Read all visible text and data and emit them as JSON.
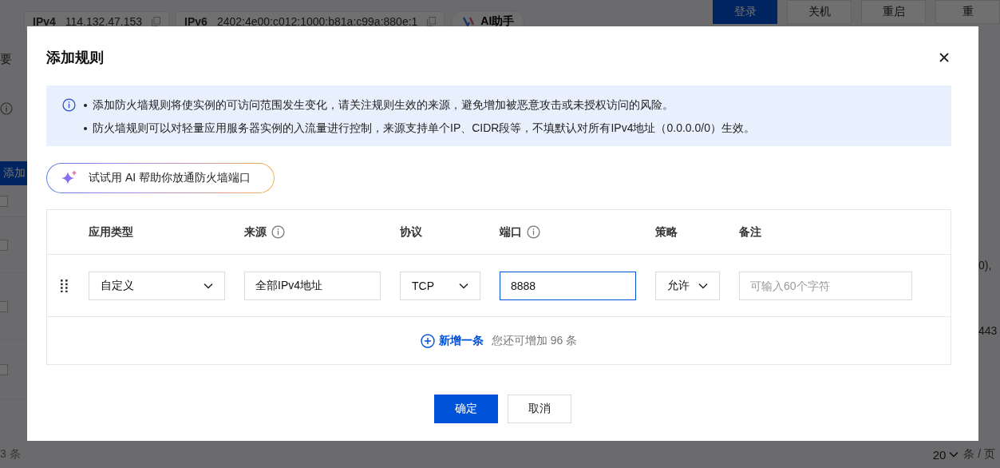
{
  "background": {
    "addresses": [
      {
        "label": "IPv4",
        "value": "114.132.47.153"
      },
      {
        "label": "IPv6",
        "value": "2402:4e00:c012:1000:b81a:c99a:880e:1"
      }
    ],
    "assistant": "AI助手",
    "actions": [
      {
        "label": "登录",
        "kind": "primary"
      },
      {
        "label": "关机",
        "kind": "default"
      },
      {
        "label": "重启",
        "kind": "default"
      },
      {
        "label": "重",
        "kind": "default"
      }
    ],
    "side_tab": "要",
    "add_button": "添加",
    "rows": [
      {
        "checked": false
      },
      {
        "checked": false
      },
      {
        "checked": false
      },
      {
        "checked": false
      }
    ],
    "row_tails": [
      "0),",
      "443"
    ],
    "total": "3 条",
    "page_size": "20",
    "page_unit": "条 / 页"
  },
  "dialog": {
    "title": "添加规则",
    "notice": [
      "添加防火墙规则将使实例的可访问范围发生变化，请关注规则生效的来源，避免增加被恶意攻击或未授权访问的风险。",
      "防火墙规则可以对轻量应用服务器实例的入流量进行控制，来源支持单个IP、CIDR段等，不填默认对所有IPv4地址（0.0.0.0/0）生效。"
    ],
    "ai_hint": "试试用 AI 帮助你放通防火墙端口",
    "columns": [
      {
        "label": "应用类型",
        "info": false
      },
      {
        "label": "来源",
        "info": true
      },
      {
        "label": "协议",
        "info": false
      },
      {
        "label": "端口",
        "info": true
      },
      {
        "label": "策略",
        "info": false
      },
      {
        "label": "备注",
        "info": false
      }
    ],
    "rows": [
      {
        "cells": [
          {
            "kind": "select",
            "value": "自定义"
          },
          {
            "kind": "input",
            "value": "全部IPv4地址",
            "focused": false
          },
          {
            "kind": "select",
            "value": "TCP"
          },
          {
            "kind": "input",
            "value": "8888",
            "focused": true
          },
          {
            "kind": "select",
            "value": "允许"
          },
          {
            "kind": "input",
            "placeholder": "可输入60个字符",
            "focused": false
          }
        ]
      }
    ],
    "add_link": "新增一条",
    "remaining": "您还可增加 96 条",
    "buttons": [
      {
        "label": "确定",
        "kind": "primary"
      },
      {
        "label": "取消",
        "kind": "default"
      }
    ]
  }
}
